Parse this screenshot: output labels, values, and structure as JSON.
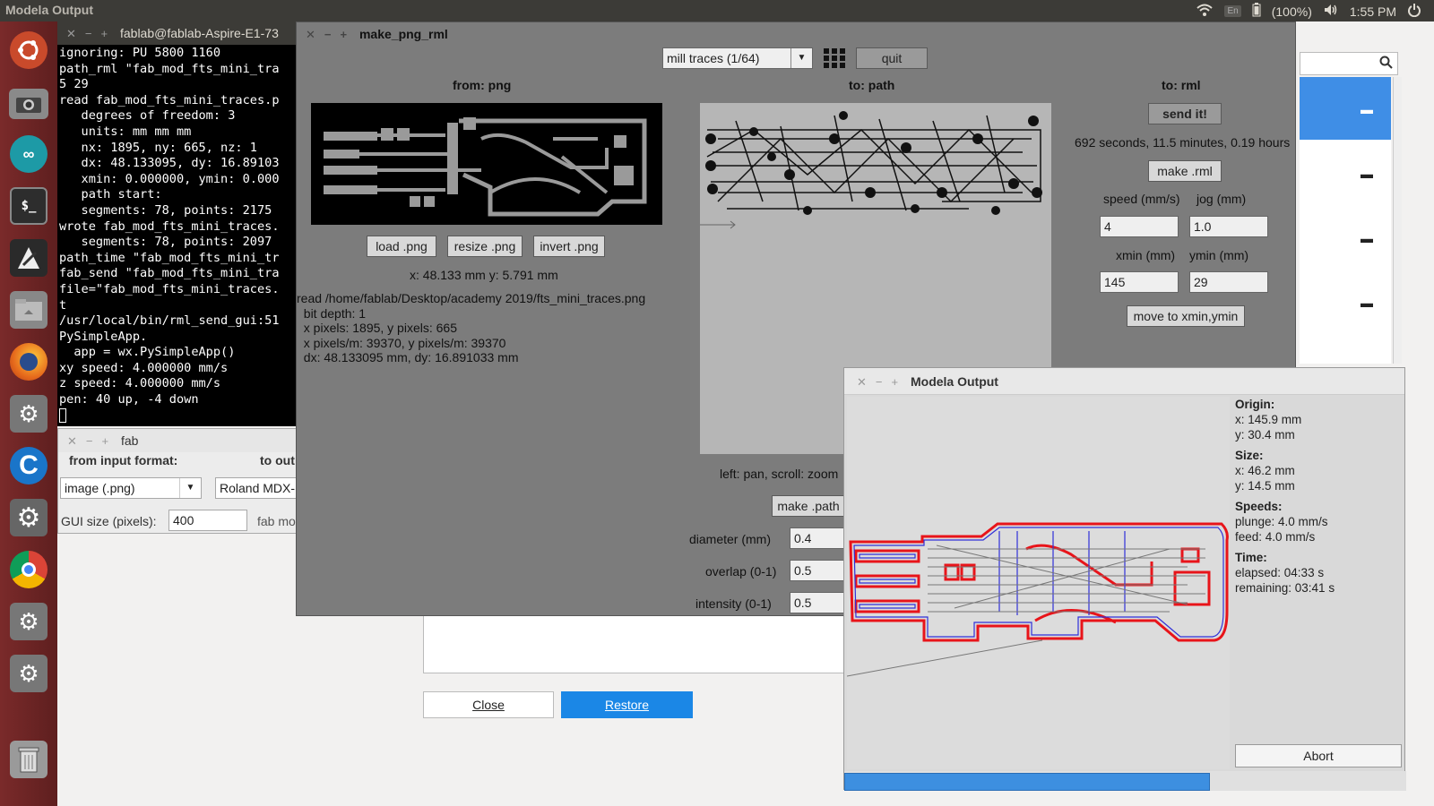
{
  "topbar": {
    "title": "Modela Output",
    "keyboard": "En",
    "battery": "(100%)",
    "clock": "1:55 PM"
  },
  "launcher": {
    "icons": [
      "ubuntu-dash-icon",
      "camera-icon",
      "arduino-icon",
      "terminal-icon",
      "inkscape-icon",
      "files-icon",
      "firefox-icon",
      "settings-icon",
      "ccleaner-icon",
      "system-settings-icon",
      "chrome-icon",
      "gear-icon",
      "gear-icon",
      "trash-icon"
    ]
  },
  "terminal": {
    "title": "fablab@fablab-Aspire-E1-73",
    "lines": [
      "ignoring: PU 5800 1160",
      "path_rml \"fab_mod_fts_mini_tra",
      "5 29",
      "read fab_mod_fts_mini_traces.p",
      "   degrees of freedom: 3",
      "   units: mm mm mm",
      "   nx: 1895, ny: 665, nz: 1",
      "   dx: 48.133095, dy: 16.89103",
      "   xmin: 0.000000, ymin: 0.000",
      "   path start:",
      "   segments: 78, points: 2175",
      "wrote fab_mod_fts_mini_traces.",
      "   segments: 78, points: 2097",
      "path_time \"fab_mod_fts_mini_tr",
      "fab_send \"fab_mod_fts_mini_tra",
      "file=\"fab_mod_fts_mini_traces.",
      "t",
      "/usr/local/bin/rml_send_gui:51",
      "PySimpleApp.",
      "  app = wx.PySimpleApp()",
      "xy speed: 4.000000 mm/s",
      "z speed: 4.000000 mm/s",
      "pen: 40 up, -4 down"
    ]
  },
  "fab": {
    "title": "fab",
    "from_label": "from input format:",
    "to_label": "to out",
    "input_format": "image (.png)",
    "output_format": "Roland MDX-",
    "gui_size_label": "GUI size (pixels):",
    "gui_size": "400",
    "fab_mod": "fab mo"
  },
  "mpr": {
    "title": "make_png_rml",
    "mode": "mill traces (1/64)",
    "quit": "quit",
    "from_png": "from: png",
    "to_path": "to: path",
    "to_rml": "to: rml",
    "send_it": "send it!",
    "time_estimate": "692 seconds, 11.5 minutes, 0.19 hours",
    "make_rml": "make .rml",
    "speed_label": "speed (mm/s)",
    "jog_label": "jog (mm)",
    "speed": "4",
    "jog": "1.0",
    "xmin_label": "xmin (mm)",
    "ymin_label": "ymin (mm)",
    "xmin": "145",
    "ymin": "29",
    "move_to": "move to xmin,ymin",
    "load_png": "load .png",
    "resize_png": "resize .png",
    "invert_png": "invert .png",
    "cursor_pos": "x: 48.133 mm  y: 5.791 mm",
    "info_lines": [
      "read /home/fablab/Desktop/academy 2019/fts_mini_traces.png",
      "  bit depth: 1",
      "  x pixels: 1895, y pixels: 665",
      "  x pixels/m: 39370, y pixels/m: 39370",
      "  dx: 48.133095 mm, dy: 16.891033 mm"
    ],
    "pan_hint": "left: pan, scroll: zoom",
    "make_path": "make .path",
    "diameter_label": "diameter (mm)",
    "diameter": "0.4",
    "overlap_label": "overlap (0-1)",
    "overlap": "0.5",
    "intensity_label": "intensity (0-1)",
    "intensity": "0.5"
  },
  "dialog": {
    "close": "Close",
    "restore": "Restore"
  },
  "modela": {
    "title": "Modela Output",
    "origin_h": "Origin:",
    "origin_x": "x: 145.9 mm",
    "origin_y": "y: 30.4 mm",
    "size_h": "Size:",
    "size_x": "x: 46.2 mm",
    "size_y": "y: 14.5 mm",
    "speeds_h": "Speeds:",
    "plunge": "plunge: 4.0 mm/s",
    "feed": "feed: 4.0 mm/s",
    "time_h": "Time:",
    "elapsed": "elapsed: 04:33 s",
    "remaining": "remaining: 03:41 s",
    "abort": "Abort",
    "progress": 0.65
  }
}
